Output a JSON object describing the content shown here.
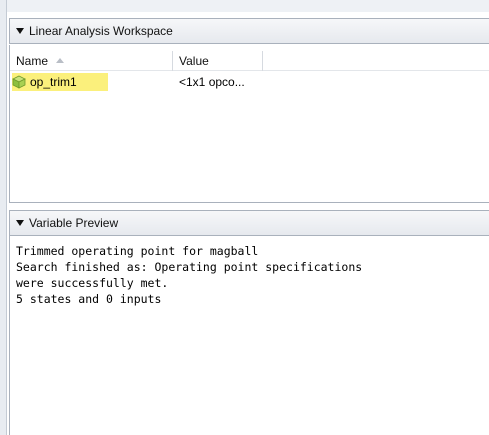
{
  "workspace": {
    "title": "Linear Analysis Workspace",
    "columns": {
      "name": "Name",
      "value": "Value"
    },
    "rows": [
      {
        "name": "op_trim1",
        "value": "<1x1 opco...",
        "icon": "operating-point-cube-icon"
      }
    ]
  },
  "preview": {
    "title": "Variable Preview",
    "lines": [
      "Trimmed operating point for magball",
      "Search finished as: Operating point specifications",
      "were successfully met.",
      "5 states and 0 inputs"
    ]
  },
  "colors": {
    "highlight": "#fbf07c",
    "icon": "#8cbf3f",
    "header_bg": "#e6e9ee"
  }
}
